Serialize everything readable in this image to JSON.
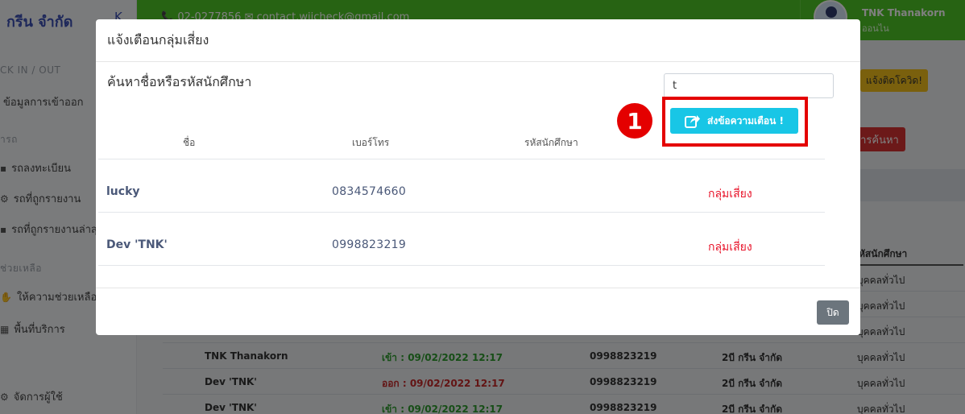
{
  "app": {
    "brand": "กรีน จำกัด",
    "brand_toggle": "K",
    "contact_text": "📞 02-0277856   ✉ contact.wiicheck@gmail.com",
    "user_name": "TNK Thanakorn",
    "user_role": "ออนไน"
  },
  "sidebar": {
    "checkin_head": "CK IN / OUT",
    "checkin_item": "ข้อมูลการเข้าออก",
    "car_head": "ารถ",
    "car_item_1": "รถลงทะเบียน",
    "car_item_2": "รถที่ถูกรายงาน",
    "car_item_3": "รถที่ถูกรายงานล่าสุด",
    "help_head": "ช่วยเหลือ",
    "help_item_1": "ให้ความช่วยเหลือ",
    "help_item_2": "พื้นที่บริการ",
    "admin_item": "จัดการผู้ใช้"
  },
  "background": {
    "covid_button": "แจ้งติดโควิด!",
    "search_button": "ารค้นหา",
    "table_header": "หัสนักศึกษา",
    "rows": [
      {
        "name": "",
        "time": "",
        "phone": "",
        "org": "",
        "type": "บุคคลทั่วไป"
      },
      {
        "name": "",
        "time": "",
        "phone": "",
        "org": "",
        "type": "บุคคลทั่วไป"
      },
      {
        "name": "",
        "time": "",
        "phone": "",
        "org": "",
        "type": "บุคคลทั่วไป"
      },
      {
        "name": "TNK Thanakorn",
        "time": "เข้า : 09/02/2022 12:17",
        "phone": "0998823219",
        "org": "2บี กรีน จำกัด",
        "type": "บุคคลทั่วไป"
      },
      {
        "name": "Dev 'TNK'",
        "time": "ออก : 09/02/2022 12:17",
        "phone": "0998823219",
        "org": "2บี กรีน จำกัด",
        "type": "บุคคลทั่วไป"
      },
      {
        "name": "Dev 'TNK'",
        "time": "เข้า : 09/02/2022 12:17",
        "phone": "0998823219",
        "org": "2บี กรีน จำกัด",
        "type": "บุคคลทั่วไป"
      }
    ]
  },
  "modal": {
    "title": "แจ้งเตือนกลุ่มเสี่ยง",
    "search_label": "ค้นหาชื่อหรือรหัสนักศึกษา",
    "search_value": "t",
    "step_marker": "1",
    "send_button": "ส่งข้อความเตือน !",
    "columns": {
      "name": "ชื่อ",
      "phone": "เบอร์โทร",
      "student_id": "รหัสนักศึกษา"
    },
    "rows": [
      {
        "name": "lucky",
        "phone": "0834574660",
        "status": "กลุ่มเสี่ยง"
      },
      {
        "name": "Dev 'TNK'",
        "phone": "0998823219",
        "status": "กลุ่มเสี่ยง"
      }
    ],
    "close_button": "ปิด"
  }
}
